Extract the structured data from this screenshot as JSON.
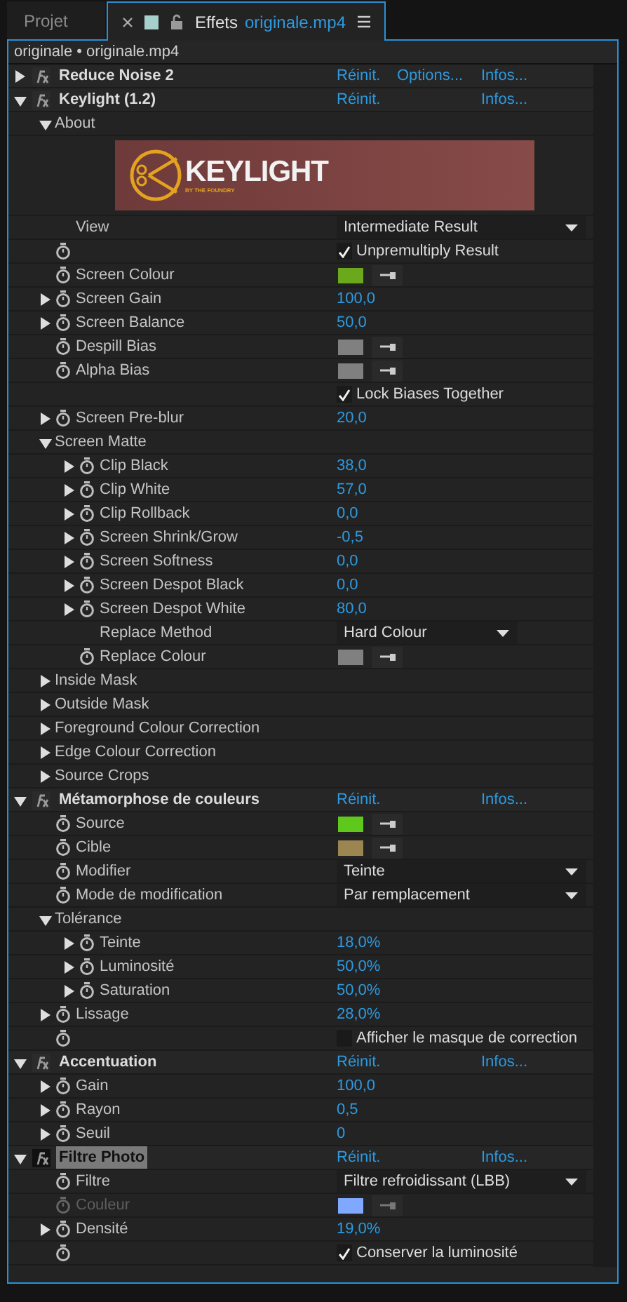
{
  "tabs": [
    {
      "label": "Projet",
      "selected": false
    },
    {
      "label": "Effets",
      "file": "originale.mp4",
      "selected": true
    }
  ],
  "breadcrumb": "originale • originale.mp4",
  "effects": [
    {
      "name": "Reduce Noise 2",
      "expanded": false,
      "selected": false,
      "links": {
        "reset": "Réinit.",
        "options": "Options...",
        "info": "Infos..."
      }
    },
    {
      "name": "Keylight (1.2)",
      "expanded": true,
      "selected": false,
      "links": {
        "reset": "Réinit.",
        "info": "Infos..."
      },
      "children": [
        {
          "kind": "group",
          "label": "About",
          "expanded": true,
          "children": [
            {
              "kind": "logo",
              "title": "KEYLIGHT",
              "subtitle": "BY THE FOUNDRY"
            }
          ]
        },
        {
          "kind": "dropdown",
          "label": "View",
          "stopwatch": false,
          "value": "Intermediate Result"
        },
        {
          "kind": "checkbox",
          "stopwatch": true,
          "checked": true,
          "value": "Unpremultiply Result"
        },
        {
          "kind": "color",
          "label": "Screen Colour",
          "stopwatch": true,
          "color": "#6aa81c"
        },
        {
          "kind": "number",
          "label": "Screen Gain",
          "stopwatch": true,
          "expanded": false,
          "value": "100,0"
        },
        {
          "kind": "number",
          "label": "Screen Balance",
          "stopwatch": true,
          "expanded": false,
          "value": "50,0"
        },
        {
          "kind": "color",
          "label": "Despill Bias",
          "stopwatch": true,
          "color": "#808080"
        },
        {
          "kind": "color",
          "label": "Alpha Bias",
          "stopwatch": true,
          "color": "#808080"
        },
        {
          "kind": "checkbox",
          "stopwatch": false,
          "checked": true,
          "value": "Lock Biases Together"
        },
        {
          "kind": "number",
          "label": "Screen Pre-blur",
          "stopwatch": true,
          "expanded": false,
          "value": "20,0"
        },
        {
          "kind": "group",
          "label": "Screen Matte",
          "expanded": true,
          "children": [
            {
              "kind": "number",
              "label": "Clip Black",
              "stopwatch": true,
              "expanded": false,
              "value": "38,0"
            },
            {
              "kind": "number",
              "label": "Clip White",
              "stopwatch": true,
              "expanded": false,
              "value": "57,0"
            },
            {
              "kind": "number",
              "label": "Clip Rollback",
              "stopwatch": true,
              "expanded": false,
              "value": "0,0"
            },
            {
              "kind": "number",
              "label": "Screen Shrink/Grow",
              "stopwatch": true,
              "expanded": false,
              "value": "-0,5"
            },
            {
              "kind": "number",
              "label": "Screen Softness",
              "stopwatch": true,
              "expanded": false,
              "value": "0,0"
            },
            {
              "kind": "number",
              "label": "Screen Despot Black",
              "stopwatch": true,
              "expanded": false,
              "value": "0,0"
            },
            {
              "kind": "number",
              "label": "Screen Despot White",
              "stopwatch": true,
              "expanded": false,
              "value": "80,0"
            },
            {
              "kind": "dropdown",
              "label": "Replace Method",
              "stopwatch": false,
              "value": "Hard Colour",
              "narrow": true
            },
            {
              "kind": "color",
              "label": "Replace Colour",
              "stopwatch": true,
              "color": "#808080"
            }
          ]
        },
        {
          "kind": "group",
          "label": "Inside Mask",
          "expanded": false
        },
        {
          "kind": "group",
          "label": "Outside Mask",
          "expanded": false
        },
        {
          "kind": "group",
          "label": "Foreground Colour Correction",
          "expanded": false
        },
        {
          "kind": "group",
          "label": "Edge Colour Correction",
          "expanded": false
        },
        {
          "kind": "group",
          "label": "Source Crops",
          "expanded": false
        }
      ]
    },
    {
      "name": "Métamorphose de couleurs",
      "expanded": true,
      "selected": false,
      "links": {
        "reset": "Réinit.",
        "info": "Infos..."
      },
      "children": [
        {
          "kind": "color",
          "label": "Source",
          "stopwatch": true,
          "color": "#5ec81c"
        },
        {
          "kind": "color",
          "label": "Cible",
          "stopwatch": true,
          "color": "#9c8550"
        },
        {
          "kind": "dropdown",
          "label": "Modifier",
          "stopwatch": true,
          "value": "Teinte"
        },
        {
          "kind": "dropdown",
          "label": "Mode de modification",
          "stopwatch": true,
          "value": "Par remplacement"
        },
        {
          "kind": "group",
          "label": "Tolérance",
          "expanded": true,
          "children": [
            {
              "kind": "number",
              "label": "Teinte",
              "stopwatch": true,
              "expanded": false,
              "value": "18,0%"
            },
            {
              "kind": "number",
              "label": "Luminosité",
              "stopwatch": true,
              "expanded": false,
              "value": "50,0%"
            },
            {
              "kind": "number",
              "label": "Saturation",
              "stopwatch": true,
              "expanded": false,
              "value": "50,0%"
            }
          ]
        },
        {
          "kind": "number",
          "label": "Lissage",
          "stopwatch": true,
          "expanded": false,
          "value": "28,0%"
        },
        {
          "kind": "checkbox",
          "stopwatch": true,
          "checked": false,
          "value": "Afficher le masque de correction"
        }
      ]
    },
    {
      "name": "Accentuation",
      "expanded": true,
      "selected": false,
      "links": {
        "reset": "Réinit.",
        "info": "Infos..."
      },
      "children": [
        {
          "kind": "number",
          "label": "Gain",
          "stopwatch": true,
          "expanded": false,
          "value": "100,0"
        },
        {
          "kind": "number",
          "label": "Rayon",
          "stopwatch": true,
          "expanded": false,
          "value": "0,5"
        },
        {
          "kind": "number",
          "label": "Seuil",
          "stopwatch": true,
          "expanded": false,
          "value": "0"
        }
      ]
    },
    {
      "name": "Filtre Photo",
      "expanded": true,
      "selected": true,
      "links": {
        "reset": "Réinit.",
        "info": "Infos..."
      },
      "children": [
        {
          "kind": "dropdown",
          "label": "Filtre",
          "stopwatch": true,
          "disabled": false,
          "value": "Filtre refroidissant (LBB)"
        },
        {
          "kind": "color",
          "label": "Couleur",
          "stopwatch": true,
          "disabled": true,
          "color": "#80a8ff"
        },
        {
          "kind": "number",
          "label": "Densité",
          "stopwatch": true,
          "disabled": false,
          "expanded": false,
          "value": "19,0%"
        },
        {
          "kind": "checkbox",
          "stopwatch": true,
          "disabled": false,
          "checked": true,
          "value": "Conserver la luminosité"
        }
      ]
    }
  ]
}
